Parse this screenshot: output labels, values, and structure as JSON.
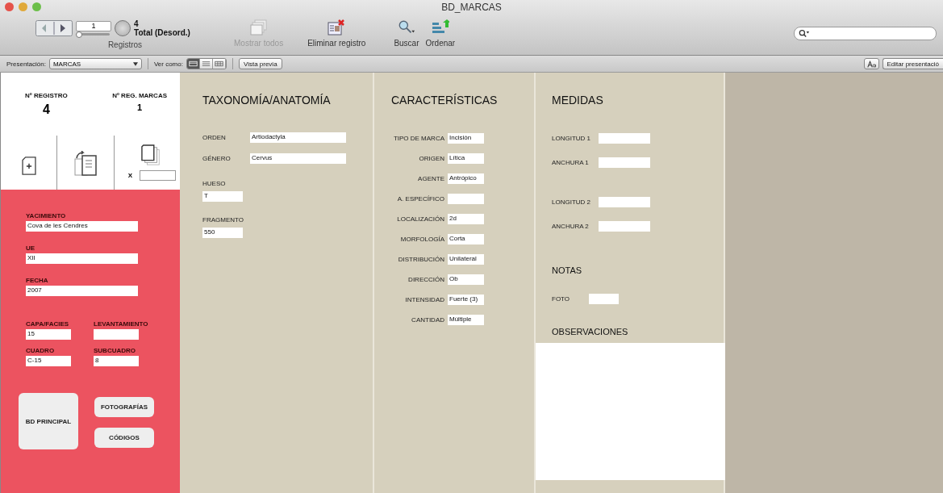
{
  "window": {
    "title": "BD_MARCAS"
  },
  "toolbar": {
    "record_field": "1",
    "record_slider": {
      "level": 0
    },
    "record_count": "4",
    "record_status": "Total (Desord.)",
    "records_label": "Registros",
    "buttons": [
      {
        "kind": "show-all",
        "label": "Mostrar todos",
        "disabled": true
      },
      {
        "kind": "delete",
        "label": "Eliminar registro",
        "disabled": false
      }
    ],
    "find_label": "Buscar",
    "sort_label": "Ordenar"
  },
  "layout_bar": {
    "layout_label": "Presentación:",
    "layout_value": "MARCAS",
    "view_label": "Ver como:",
    "view_modes": [
      {
        "kind": "form",
        "selected": true
      },
      {
        "kind": "list",
        "selected": false
      },
      {
        "kind": "table",
        "selected": false
      }
    ],
    "preview_button": "Vista previa",
    "edit_layout_button": "Editar presentació"
  },
  "left_panel": {
    "counters": [
      {
        "label": "Nº REGISTRO",
        "value": "4"
      },
      {
        "label": "Nº REG. MARCAS",
        "value": "1"
      }
    ],
    "copies_label": "X",
    "site_fields": [
      {
        "label": "YACIMIENTO",
        "value": "Cova de les Cendres"
      },
      {
        "label": "UE",
        "value": "XII"
      },
      {
        "label": "FECHA",
        "value": "2007"
      }
    ],
    "grid_fields": [
      {
        "label": "CAPA/FACIES",
        "value": "15"
      },
      {
        "label": "LEVANTAMIENTO"
      },
      {
        "label": "CUADRO",
        "value": "C-15"
      },
      {
        "label": "SUBCUADRO",
        "value": "8"
      }
    ],
    "main_button": "BD PRINCIPAL",
    "buttons": [
      "FOTOGRAFÍAS",
      "CÓDIGOS"
    ]
  },
  "taxonomy": {
    "title": "TAXONOMÍA/ANATOMÍA",
    "inline_fields": [
      {
        "label": "ORDEN",
        "value": "Artiodactyla"
      },
      {
        "label": "GÉNERO",
        "value": "Cervus"
      }
    ],
    "stacked_fields": [
      {
        "label": "HUESO",
        "value": "T"
      },
      {
        "label": "FRAGMENTO",
        "value": "550"
      }
    ]
  },
  "characteristics": {
    "title": "CARACTERÍSTICAS",
    "fields": [
      {
        "label": "TIPO DE MARCA",
        "value": "Incisión"
      },
      {
        "label": "ORIGEN",
        "value": "Lítica"
      },
      {
        "label": "AGENTE",
        "value": "Antrópico"
      },
      {
        "label": "A. ESPECÍFICO"
      },
      {
        "label": "LOCALIZACIÓN",
        "value": "2d"
      },
      {
        "label": "MORFOLOGÍA",
        "value": "Corta"
      },
      {
        "label": "DISTRIBUCIÓN",
        "value": "Unilateral"
      },
      {
        "label": "DIRECCIÓN",
        "value": "Ob"
      },
      {
        "label": "INTENSIDAD",
        "value": "Fuerte (3)"
      },
      {
        "label": "CANTIDAD",
        "value": "Múltiple"
      }
    ]
  },
  "measures": {
    "title": "MEDIDAS",
    "groups": [
      [
        {
          "label": "LONGITUD 1"
        },
        {
          "label": "ANCHURA 1"
        }
      ],
      [
        {
          "label": "LONGITUD 2"
        },
        {
          "label": "ANCHURA 2"
        }
      ]
    ],
    "notes_title": "NOTAS",
    "photo_label": "FOTO",
    "observations_title": "OBSERVACIONES"
  }
}
